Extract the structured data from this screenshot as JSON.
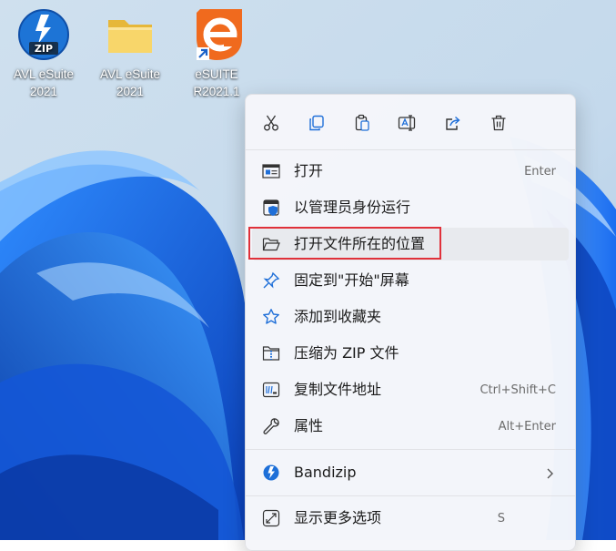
{
  "desktop": {
    "icons": [
      {
        "label_line1": "AVL eSuite",
        "label_line2": "2021",
        "icon": "zip-archive-icon"
      },
      {
        "label_line1": "AVL eSuite",
        "label_line2": "2021",
        "icon": "folder-icon"
      },
      {
        "label_line1": "eSUITE",
        "label_line2": "R2021.1",
        "icon": "esuite-app-icon"
      }
    ]
  },
  "context_menu": {
    "toolbar": [
      {
        "name": "cut",
        "icon": "cut-icon"
      },
      {
        "name": "copy",
        "icon": "copy-icon"
      },
      {
        "name": "paste",
        "icon": "paste-icon"
      },
      {
        "name": "rename",
        "icon": "rename-icon"
      },
      {
        "name": "share",
        "icon": "share-icon"
      },
      {
        "name": "delete",
        "icon": "delete-icon"
      }
    ],
    "items": [
      {
        "label": "打开",
        "shortcut": "Enter",
        "icon": "open-app-icon"
      },
      {
        "label": "以管理员身份运行",
        "shortcut": "",
        "icon": "shield-icon"
      },
      {
        "label": "打开文件所在的位置",
        "shortcut": "",
        "icon": "folder-open-icon"
      },
      {
        "label": "固定到\"开始\"屏幕",
        "shortcut": "",
        "icon": "pin-icon"
      },
      {
        "label": "添加到收藏夹",
        "shortcut": "",
        "icon": "star-icon"
      },
      {
        "label": "压缩为 ZIP 文件",
        "shortcut": "",
        "icon": "zip-folder-icon"
      },
      {
        "label": "复制文件地址",
        "shortcut": "Ctrl+Shift+C",
        "icon": "copy-path-icon"
      },
      {
        "label": "属性",
        "shortcut": "Alt+Enter",
        "icon": "wrench-icon"
      },
      {
        "label": "Bandizip",
        "shortcut": "",
        "icon": "bandizip-icon"
      },
      {
        "label": "显示更多选项",
        "shortcut": "S",
        "icon": "more-options-icon"
      }
    ]
  },
  "colors": {
    "highlight_border": "#e0313a",
    "accent_blue": "#1f6fd8",
    "esuite_orange": "#f06a1e"
  }
}
